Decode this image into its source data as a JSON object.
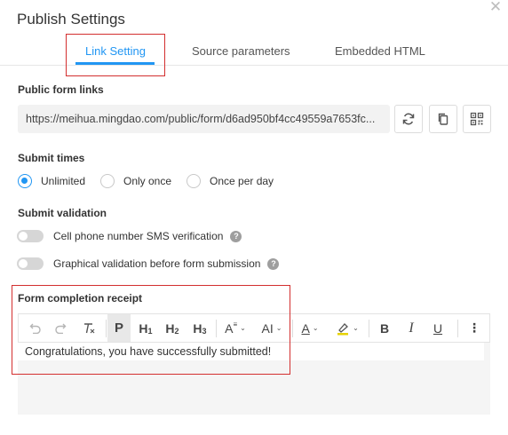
{
  "dialog": {
    "title": "Publish Settings",
    "close_icon": "close-icon"
  },
  "tabs": [
    {
      "label": "Link Setting",
      "active": true
    },
    {
      "label": "Source parameters",
      "active": false
    },
    {
      "label": "Embedded HTML",
      "active": false
    }
  ],
  "public_links": {
    "label": "Public form links",
    "url": "https://meihua.mingdao.com/public/form/d6ad950bf4cc49559a7653fc...",
    "buttons": [
      "refresh-icon",
      "copy-icon",
      "qrcode-icon"
    ]
  },
  "submit_times": {
    "label": "Submit times",
    "options": [
      {
        "label": "Unlimited",
        "checked": true
      },
      {
        "label": "Only once",
        "checked": false
      },
      {
        "label": "Once per day",
        "checked": false
      }
    ]
  },
  "submit_validation": {
    "label": "Submit validation",
    "options": [
      {
        "label": "Cell phone number SMS verification",
        "enabled": false,
        "help": "?"
      },
      {
        "label": "Graphical validation before form submission",
        "enabled": false,
        "help": "?"
      }
    ]
  },
  "receipt": {
    "label": "Form completion receipt",
    "content": "Congratulations, you have successfully submitted!",
    "toolbar": {
      "paragraph": "P",
      "h": "H",
      "h1": "1",
      "h2": "2",
      "h3": "3",
      "font_size": "A",
      "letter_spacing": "AI",
      "font_color": "A",
      "bold": "B",
      "italic": "I",
      "underline": "U",
      "more": "⋮"
    }
  },
  "colors": {
    "accent": "#2196f3",
    "highlight_border": "#d32f2f"
  }
}
